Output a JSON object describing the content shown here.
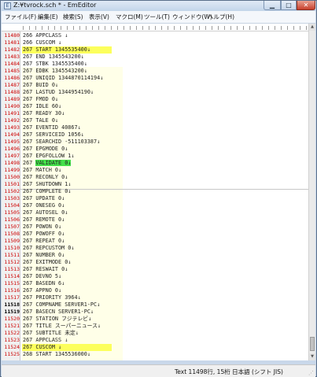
{
  "window": {
    "title": "Z:¥tvrock.sch * - EmEditor",
    "minimize_glyph": "▁",
    "maximize_glyph": "□",
    "close_glyph": "✕",
    "icon": "emeditor-app-icon"
  },
  "menu": [
    {
      "label": "ファイル(F)"
    },
    {
      "label": "編集(E)"
    },
    {
      "label": "検索(S)"
    },
    {
      "label": "表示(V)"
    },
    {
      "label": "マクロ(M)"
    },
    {
      "label": "ツール(T)"
    },
    {
      "label": "ウィンドウ(W)"
    },
    {
      "label": "ヘルプ(H)"
    }
  ],
  "editor": {
    "lines": [
      {
        "num": "11480",
        "text": "266 APPCLASS ↓"
      },
      {
        "num": "11481",
        "text": "266 CUSCOM ↓"
      },
      {
        "num": "11482",
        "text": "267 START 1345535400↓"
      },
      {
        "num": "11483",
        "text": "267 END 1345543200↓"
      },
      {
        "num": "11484",
        "text": "267 STBK 1345535400↓"
      },
      {
        "num": "11485",
        "text": "267 EDBK 1345543200↓"
      },
      {
        "num": "11486",
        "text": "267 UNIQID 1344870114194↓"
      },
      {
        "num": "11487",
        "text": "267 BUID 0↓"
      },
      {
        "num": "11488",
        "text": "267 LASTUD 1344954190↓"
      },
      {
        "num": "11489",
        "text": "267 FMOD 0↓"
      },
      {
        "num": "11490",
        "text": "267 IDLE 60↓"
      },
      {
        "num": "11491",
        "text": "267 READY 30↓"
      },
      {
        "num": "11492",
        "text": "267 TALE 0↓"
      },
      {
        "num": "11493",
        "text": "267 EVENTID 40867↓"
      },
      {
        "num": "11494",
        "text": "267 SERVICEID 1056↓"
      },
      {
        "num": "11495",
        "text": "267 SEARCHID -511103387↓"
      },
      {
        "num": "11496",
        "text": "267 EPGMODE 0↓"
      },
      {
        "num": "11497",
        "text": "267 EPGFOLLOW 1↓"
      },
      {
        "num": "11498",
        "prefix": "267 ",
        "highlight": "VALIDATE 0↓"
      },
      {
        "num": "11499",
        "text": "267 MATCH 0↓"
      },
      {
        "num": "11500",
        "text": "267 RECONLY 0↓"
      },
      {
        "num": "11501",
        "text": "267 SHUTDOWN 1↓"
      },
      {
        "num": "11502",
        "text": "267 COMPLETE 0↓"
      },
      {
        "num": "11503",
        "text": "267 UPDATE 0↓"
      },
      {
        "num": "11504",
        "text": "267 ONESEG 0↓"
      },
      {
        "num": "11505",
        "text": "267 AUTOSEL 0↓"
      },
      {
        "num": "11506",
        "text": "267 REMOTE 0↓"
      },
      {
        "num": "11507",
        "text": "267 POWON 0↓"
      },
      {
        "num": "11508",
        "text": "267 POWOFF 0↓"
      },
      {
        "num": "11509",
        "text": "267 REPEAT 0↓"
      },
      {
        "num": "11510",
        "text": "267 REPCUSTOM 0↓"
      },
      {
        "num": "11511",
        "text": "267 NUMBER 0↓"
      },
      {
        "num": "11512",
        "text": "267 EXITMODE 0↓"
      },
      {
        "num": "11513",
        "text": "267 RESWAIT 0↓"
      },
      {
        "num": "11514",
        "text": "267 DEVNO 5↓"
      },
      {
        "num": "11515",
        "text": "267 BASEDN 6↓"
      },
      {
        "num": "11516",
        "text": "267 APPNO 0↓"
      },
      {
        "num": "11517",
        "text": "267 PRIORITY 3964↓"
      },
      {
        "num": "11518",
        "text": "267 COMPNAME SERVER1-PC↓"
      },
      {
        "num": "11519",
        "text": "267 BASECN SERVER1-PC↓"
      },
      {
        "num": "11520",
        "text": "267 STATION フジテレビ↓"
      },
      {
        "num": "11521",
        "text": "267 TITLE スーパーニュース↓"
      },
      {
        "num": "11522",
        "text": "267 SUBTITLE 未定↓"
      },
      {
        "num": "11523",
        "text": "267 APPCLASS ↓"
      },
      {
        "num": "11524",
        "text": "267 CUSCOM ↓"
      },
      {
        "num": "11525",
        "text": "268 START 1345536000↓"
      }
    ]
  },
  "status": {
    "text": "Text  11498行, 15桁  日本語 (シフト JIS)"
  },
  "scrollbar": {
    "up_glyph": "▲",
    "down_glyph": "▼"
  },
  "colors": {
    "line_highlight": "#fcff5c",
    "match_highlight": "#44e04a",
    "marker_red": "#cc0000"
  }
}
